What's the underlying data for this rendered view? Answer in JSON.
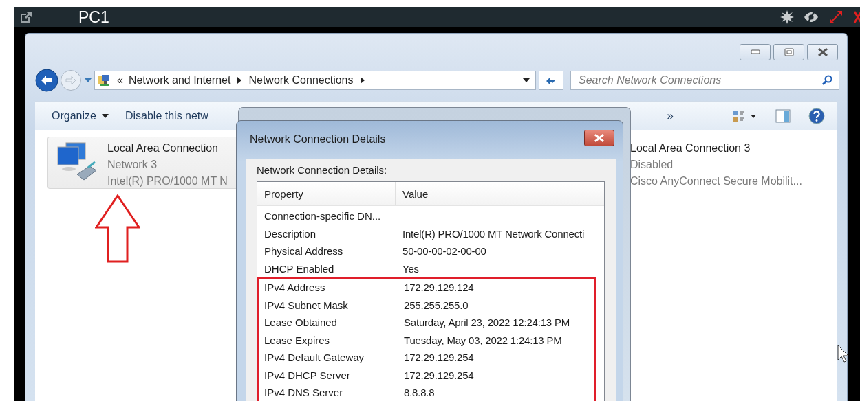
{
  "host_bar": {
    "title": "PC1"
  },
  "window": {
    "address": {
      "overflow": "«",
      "breadcrumbs": [
        "Network and Internet",
        "Network Connections"
      ]
    },
    "search": {
      "placeholder": "Search Network Connections"
    },
    "toolbar": {
      "items": [
        "Organize",
        "Disable this netw"
      ],
      "more": "»"
    },
    "connections": [
      {
        "name": "Local Area Connection",
        "status": "Network  3",
        "device": "Intel(R) PRO/1000 MT N",
        "selected": true
      },
      {
        "name": "Local Area Connection 3",
        "status": "Disabled",
        "device": "Cisco AnyConnect Secure Mobilit...",
        "selected": false
      }
    ]
  },
  "dialog": {
    "title": "Network Connection Details",
    "label": "Network Connection Details:",
    "columns": [
      "Property",
      "Value"
    ],
    "rows": [
      {
        "property": "Connection-specific DN...",
        "value": "",
        "highlighted": false
      },
      {
        "property": "Description",
        "value": "Intel(R) PRO/1000 MT Network Connecti",
        "highlighted": false
      },
      {
        "property": "Physical Address",
        "value": "50-00-00-02-00-00",
        "highlighted": false
      },
      {
        "property": "DHCP Enabled",
        "value": "Yes",
        "highlighted": false
      },
      {
        "property": "IPv4 Address",
        "value": "172.29.129.124",
        "highlighted": true
      },
      {
        "property": "IPv4 Subnet Mask",
        "value": "255.255.255.0",
        "highlighted": true
      },
      {
        "property": "Lease Obtained",
        "value": "Saturday, April 23, 2022 12:24:13 PM",
        "highlighted": true
      },
      {
        "property": "Lease Expires",
        "value": "Tuesday, May 03, 2022 1:24:13 PM",
        "highlighted": true
      },
      {
        "property": "IPv4 Default Gateway",
        "value": "172.29.129.254",
        "highlighted": true
      },
      {
        "property": "IPv4 DHCP Server",
        "value": "172.29.129.254",
        "highlighted": true
      },
      {
        "property": "IPv4 DNS Server",
        "value": "8.8.8.8",
        "highlighted": true
      }
    ]
  }
}
